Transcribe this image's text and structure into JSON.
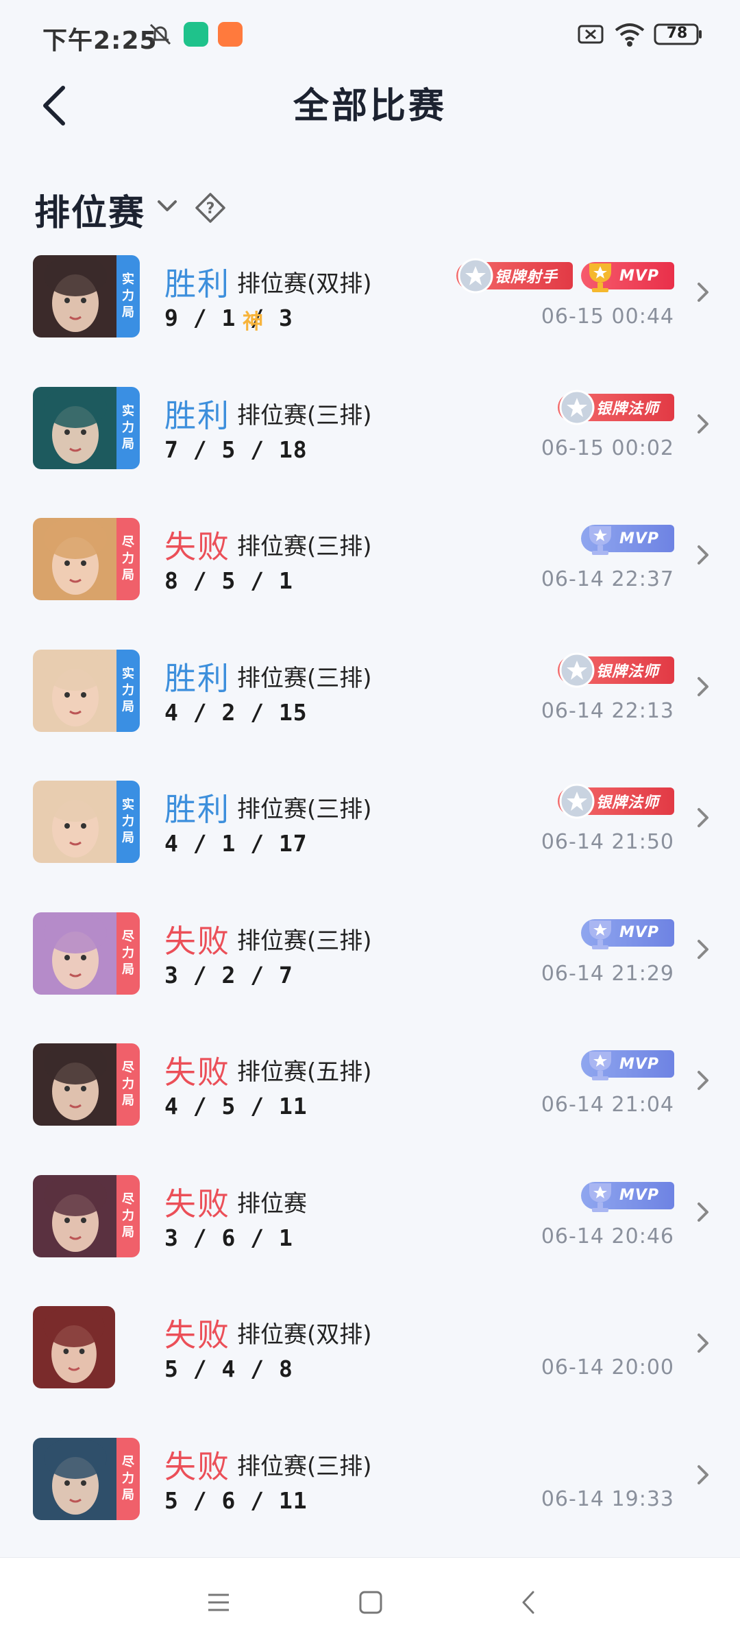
{
  "status_bar": {
    "time": "下午2:25",
    "battery": "78",
    "icons": [
      "bell-muted-icon",
      "shield-app-icon",
      "shop-app-icon",
      "sim-off-icon",
      "wifi-icon",
      "battery-icon"
    ]
  },
  "header": {
    "title": "全部比赛",
    "back_icon": "back-arrow-icon"
  },
  "filter": {
    "label": "排位赛",
    "dropdown_icon": "chevron-down-icon",
    "help_icon": "help-diamond-icon"
  },
  "matches": [
    {
      "badge": [
        "实",
        "力",
        "局"
      ],
      "badge_color": "#3a8fe3",
      "result": "胜利",
      "win": true,
      "mode": "排位赛(双排)",
      "kda": "9 / 1 / 3",
      "god": "神",
      "time": "06-15 00:44",
      "honors": [
        {
          "type": "silver",
          "label": "银牌射手"
        },
        {
          "type": "mvp-gold",
          "label": "MVP"
        }
      ],
      "hue": "#3b2a2a"
    },
    {
      "badge": [
        "实",
        "力",
        "局"
      ],
      "badge_color": "#3a8fe3",
      "result": "胜利",
      "win": true,
      "mode": "排位赛(三排)",
      "kda": "7 / 5 / 18",
      "god": "",
      "time": "06-15 00:02",
      "honors": [
        {
          "type": "silver",
          "label": "银牌法师"
        }
      ],
      "hue": "#1d5a5e"
    },
    {
      "badge": [
        "尽",
        "力",
        "局"
      ],
      "badge_color": "#f0606a",
      "result": "失败",
      "win": false,
      "mode": "排位赛(三排)",
      "kda": "8 / 5 / 1",
      "god": "",
      "time": "06-14 22:37",
      "honors": [
        {
          "type": "mvp-blue",
          "label": "MVP"
        }
      ],
      "hue": "#d9a36a"
    },
    {
      "badge": [
        "实",
        "力",
        "局"
      ],
      "badge_color": "#3a8fe3",
      "result": "胜利",
      "win": true,
      "mode": "排位赛(三排)",
      "kda": "4 / 2 / 15",
      "god": "",
      "time": "06-14 22:13",
      "honors": [
        {
          "type": "silver",
          "label": "银牌法师"
        }
      ],
      "hue": "#e8cdb0"
    },
    {
      "badge": [
        "实",
        "力",
        "局"
      ],
      "badge_color": "#3a8fe3",
      "result": "胜利",
      "win": true,
      "mode": "排位赛(三排)",
      "kda": "4 / 1 / 17",
      "god": "",
      "time": "06-14 21:50",
      "honors": [
        {
          "type": "silver",
          "label": "银牌法师"
        }
      ],
      "hue": "#e8cdb0"
    },
    {
      "badge": [
        "尽",
        "力",
        "局"
      ],
      "badge_color": "#f0606a",
      "result": "失败",
      "win": false,
      "mode": "排位赛(三排)",
      "kda": "3 / 2 / 7",
      "god": "",
      "time": "06-14 21:29",
      "honors": [
        {
          "type": "mvp-blue",
          "label": "MVP"
        }
      ],
      "hue": "#b58bc9"
    },
    {
      "badge": [
        "尽",
        "力",
        "局"
      ],
      "badge_color": "#f0606a",
      "result": "失败",
      "win": false,
      "mode": "排位赛(五排)",
      "kda": "4 / 5 / 11",
      "god": "",
      "time": "06-14 21:04",
      "honors": [
        {
          "type": "mvp-blue",
          "label": "MVP"
        }
      ],
      "hue": "#3b2a2a"
    },
    {
      "badge": [
        "尽",
        "力",
        "局"
      ],
      "badge_color": "#f0606a",
      "result": "失败",
      "win": false,
      "mode": "排位赛",
      "kda": "3 / 6 / 1",
      "god": "",
      "time": "06-14 20:46",
      "honors": [
        {
          "type": "mvp-blue",
          "label": "MVP"
        }
      ],
      "hue": "#5a3140"
    },
    {
      "badge": [],
      "badge_color": "",
      "result": "失败",
      "win": false,
      "mode": "排位赛(双排)",
      "kda": "5 / 4 / 8",
      "god": "",
      "time": "06-14 20:00",
      "honors": [],
      "hue": "#7a2b2b"
    },
    {
      "badge": [
        "尽",
        "力",
        "局"
      ],
      "badge_color": "#f0606a",
      "result": "失败",
      "win": false,
      "mode": "排位赛(三排)",
      "kda": "5 / 6 / 11",
      "god": "",
      "time": "06-14 19:33",
      "honors": [],
      "hue": "#2f4f6a"
    }
  ],
  "nav": {
    "icons": [
      "menu-icon",
      "home-square-icon",
      "back-triangle-icon"
    ]
  }
}
